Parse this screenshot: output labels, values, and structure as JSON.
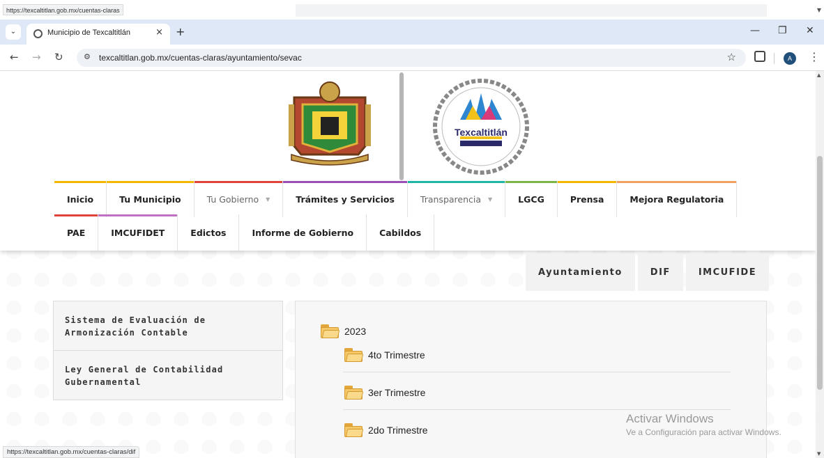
{
  "top_strip": {
    "hover_url": "https://texcaltitlan.gob.mx/cuentas-claras"
  },
  "browser": {
    "tab_title": "Municipio de Texcaltitlán",
    "tab_close": "×",
    "new_tab": "+",
    "dropdown": "⌄",
    "minimize": "—",
    "restore": "❐",
    "close": "✕",
    "url": "texcaltitlan.gob.mx/cuentas-claras/ayuntamiento/sevac",
    "avatar_letter": "A"
  },
  "header": {
    "logo_text": "Texcaltitlán",
    "crest_icon": "municipal-coat-of-arms-icon",
    "logo_icon": "government-round-logo-icon"
  },
  "nav": {
    "row1": [
      {
        "label": "Inicio",
        "color": "#f5b800",
        "light": false
      },
      {
        "label": "Tu Municipio",
        "color": "#f5b800",
        "light": false
      },
      {
        "label": "Tu Gobierno",
        "color": "#e0433a",
        "light": true,
        "caret": true
      },
      {
        "label": "Trámites y Servicios",
        "color": "#9b4fb5",
        "light": false
      },
      {
        "label": "Transparencia",
        "color": "#1fb5a5",
        "light": true,
        "caret": true
      },
      {
        "label": "LGCG",
        "color": "#7ab648",
        "light": false
      },
      {
        "label": "Prensa",
        "color": "#f5b800",
        "light": false
      },
      {
        "label": "Mejora Regulatoria",
        "color": "#f0a060",
        "light": false
      }
    ],
    "row2": [
      {
        "label": "PAE",
        "color": "#e0433a",
        "light": false
      },
      {
        "label": "IMCUFIDET",
        "color": "#c070c0",
        "light": false
      },
      {
        "label": "Edictos",
        "color": "",
        "light": false
      },
      {
        "label": "Informe de Gobierno",
        "color": "",
        "light": false
      },
      {
        "label": "Cabildos",
        "color": "",
        "light": false
      }
    ]
  },
  "subtabs": [
    "Ayuntamiento",
    "DIF",
    "IMCUFIDE"
  ],
  "sidebar": [
    "Sistema de Evaluación de Armonización Contable",
    "Ley General de Contabilidad Gubernamental"
  ],
  "tree": {
    "year": "2023",
    "items": [
      "4to Trimestre",
      "3er Trimestre",
      "2do Trimestre"
    ]
  },
  "watermark": {
    "line1": "Activar Windows",
    "line2": "Ve a Configuración para activar Windows."
  },
  "status_bar": {
    "url": "https://texcaltitlan.gob.mx/cuentas-claras/dif"
  }
}
